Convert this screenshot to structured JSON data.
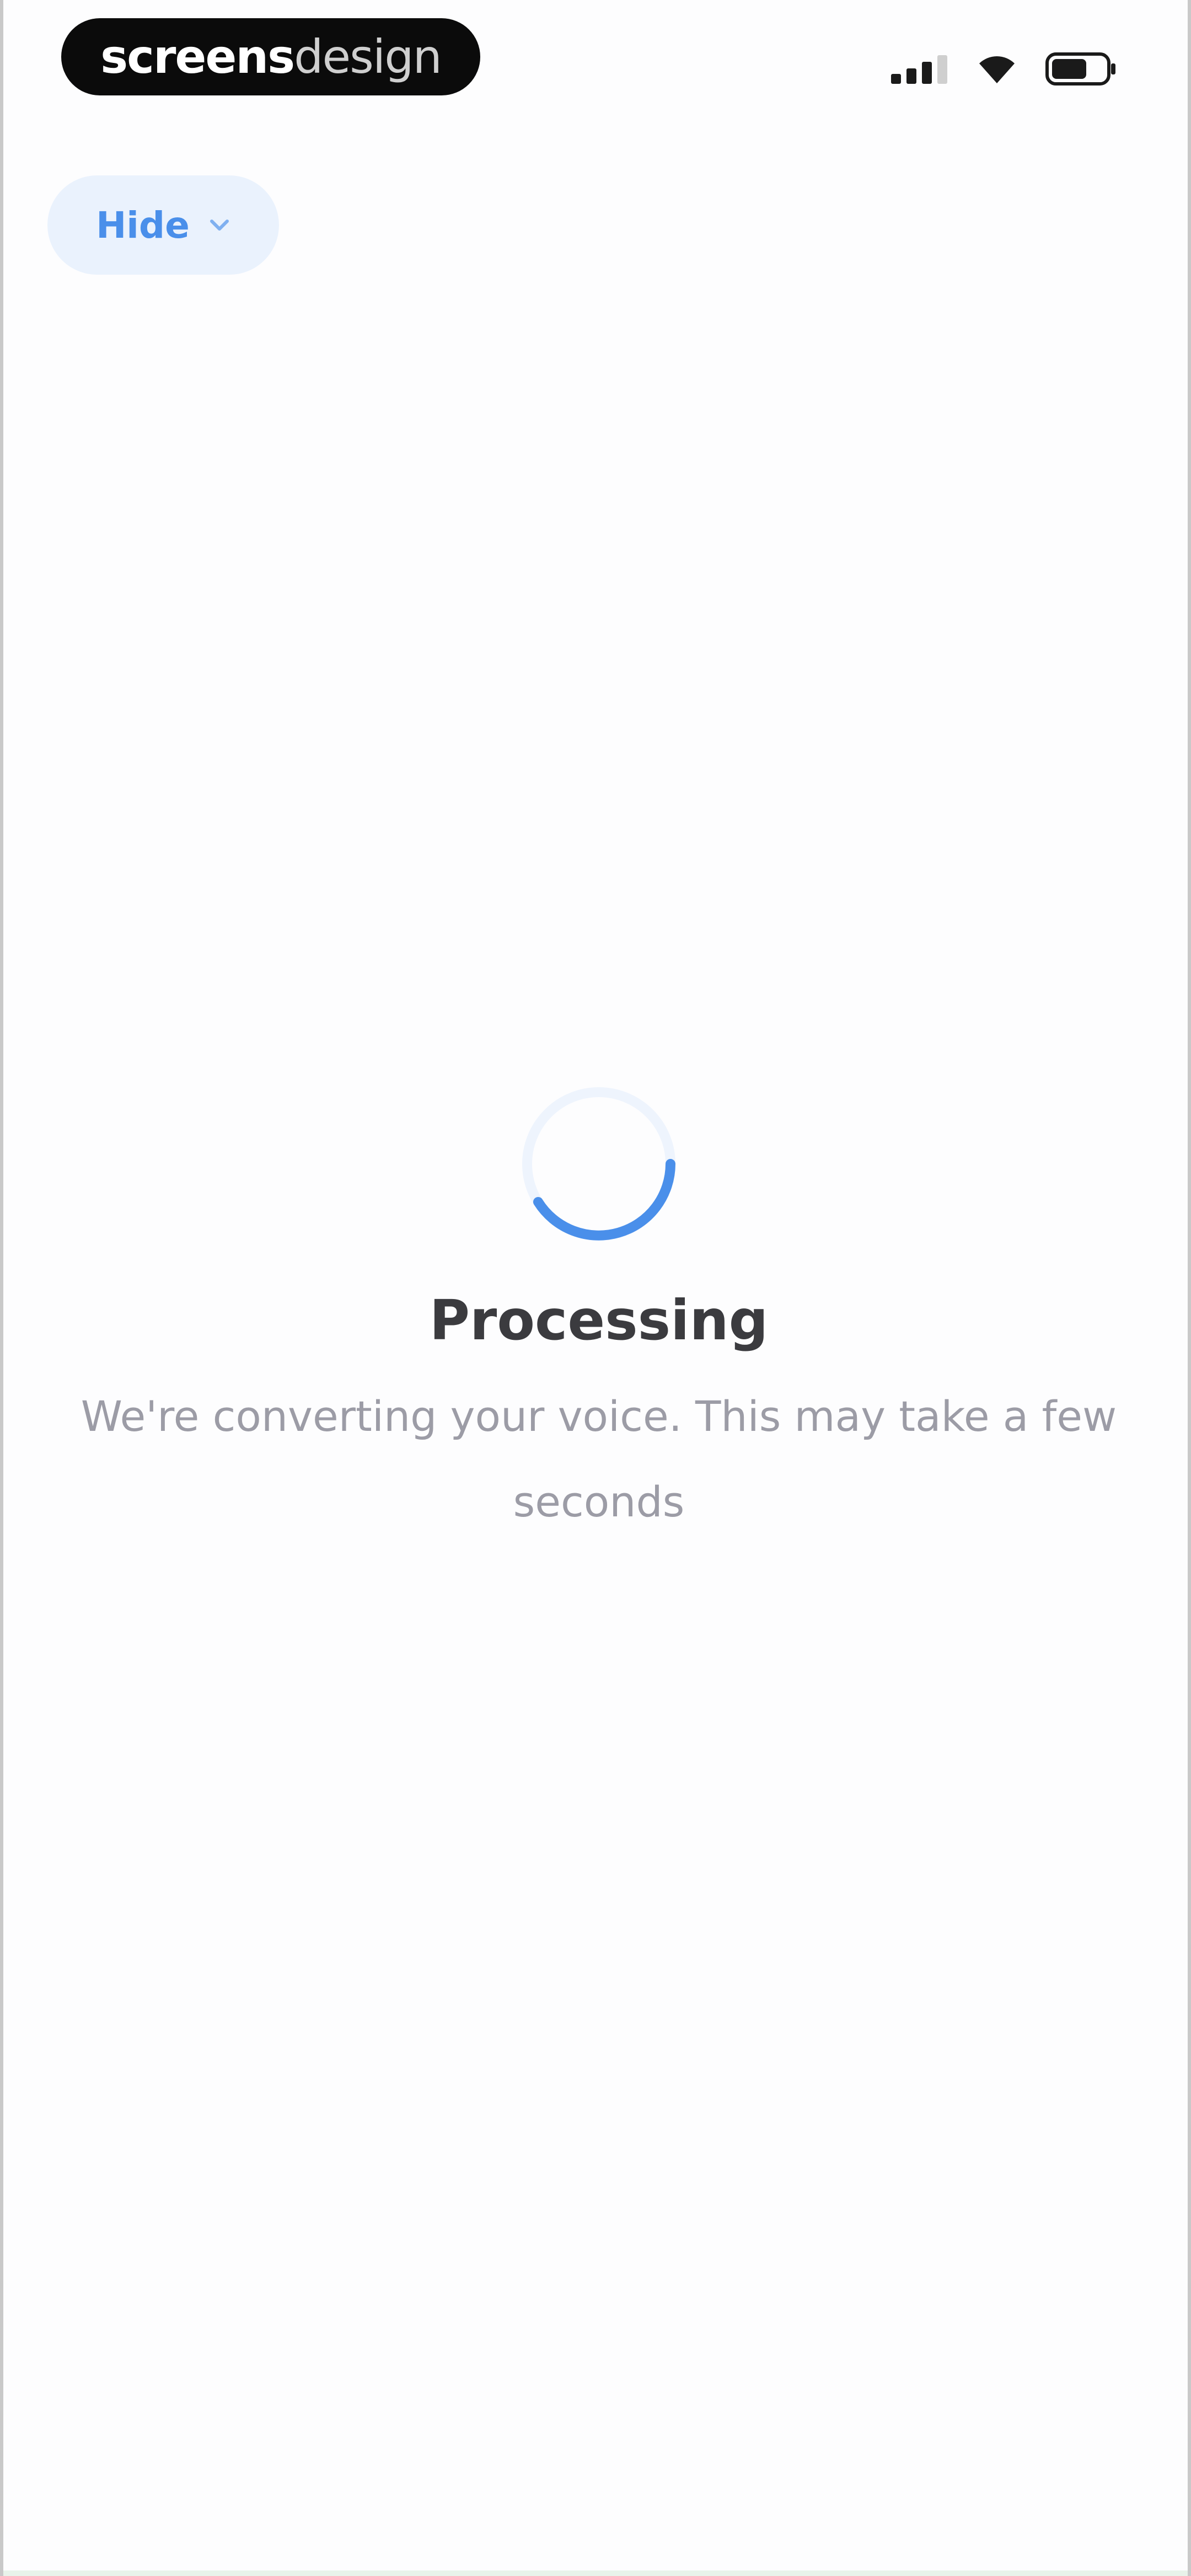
{
  "status_bar": {
    "brand_bold": "screens",
    "brand_light": "design",
    "icons": [
      "signal-icon",
      "wifi-icon",
      "battery-icon"
    ]
  },
  "header": {
    "hide_label": "Hide",
    "hide_icon": "chevron-down-icon"
  },
  "processing": {
    "title": "Processing",
    "message": "We're converting your voice. This may take a few seconds"
  },
  "colors": {
    "accent": "#4a8fea",
    "accent_soft": "#eaf2fd",
    "title": "#3b3b3f",
    "subtitle": "#9c9ca6"
  }
}
